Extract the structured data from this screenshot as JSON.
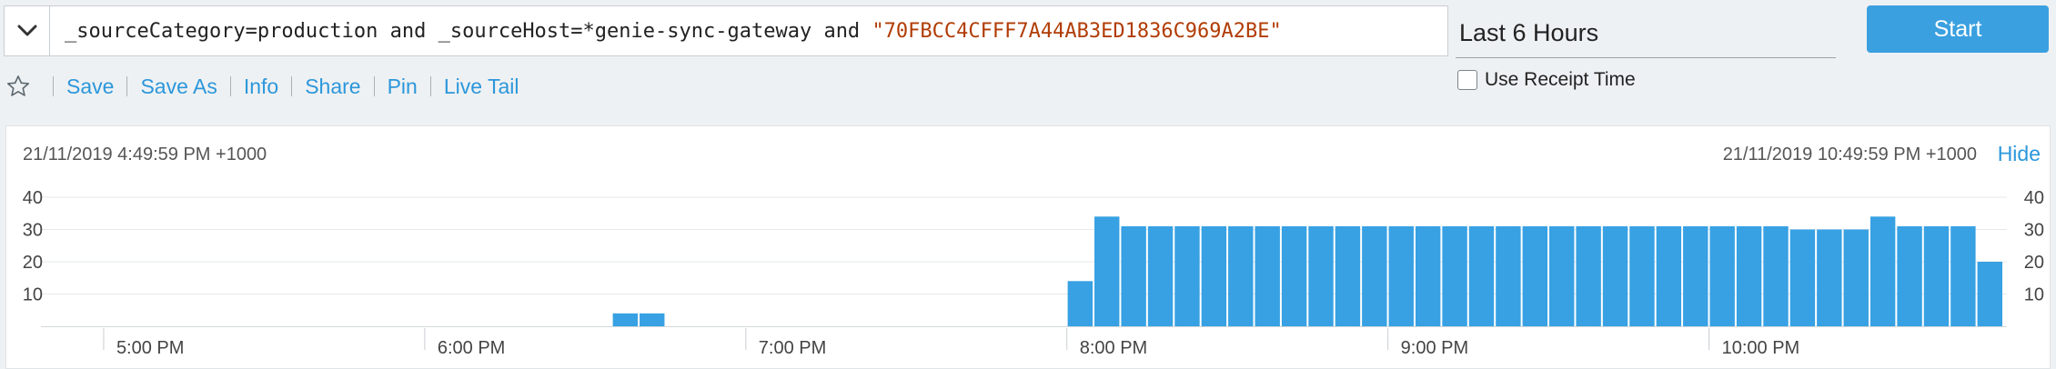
{
  "query": {
    "text_plain": "_sourceCategory=production and _sourceHost=*genie-sync-gateway and ",
    "text_string": "\"70FBCC4CFFF7A44AB3ED1836C969A2BE\""
  },
  "time_range": {
    "value": "Last 6 Hours"
  },
  "start_button": {
    "label": "Start"
  },
  "receipt_time": {
    "label": "Use Receipt Time",
    "checked": false
  },
  "actions": [
    {
      "label": "Save"
    },
    {
      "label": "Save As"
    },
    {
      "label": "Info"
    },
    {
      "label": "Share"
    },
    {
      "label": "Pin"
    },
    {
      "label": "Live Tail"
    }
  ],
  "histogram": {
    "range_start": "21/11/2019 4:49:59 PM +1000",
    "range_end": "21/11/2019 10:49:59 PM +1000",
    "hide_label": "Hide"
  },
  "colors": {
    "bar": "#37a1e3",
    "link": "#2c97db",
    "query_string": "#b13c06",
    "button": "#3aa0e0"
  },
  "chart_data": {
    "type": "bar",
    "ylim": [
      0,
      40
    ],
    "yticks": [
      10,
      20,
      30,
      40
    ],
    "grid": true,
    "x_start_minutes": 1009.98,
    "bin_minutes": 5,
    "time_ticks": [
      {
        "label": "5:00 PM",
        "minutes": 1020
      },
      {
        "label": "6:00 PM",
        "minutes": 1080
      },
      {
        "label": "7:00 PM",
        "minutes": 1140
      },
      {
        "label": "8:00 PM",
        "minutes": 1200
      },
      {
        "label": "9:00 PM",
        "minutes": 1260
      },
      {
        "label": "10:00 PM",
        "minutes": 1320
      }
    ],
    "values": [
      0,
      0,
      0,
      0,
      0,
      0,
      0,
      0,
      0,
      0,
      0,
      0,
      0,
      0,
      0,
      0,
      0,
      0,
      0,
      0,
      0,
      4,
      4,
      0,
      0,
      0,
      0,
      0,
      0,
      0,
      0,
      0,
      0,
      0,
      0,
      0,
      0,
      0,
      14,
      34,
      31,
      31,
      31,
      31,
      31,
      31,
      31,
      31,
      31,
      31,
      31,
      31,
      31,
      31,
      31,
      31,
      31,
      31,
      31,
      31,
      31,
      31,
      31,
      31,
      31,
      30,
      30,
      30,
      34,
      31,
      31,
      31,
      20
    ]
  }
}
